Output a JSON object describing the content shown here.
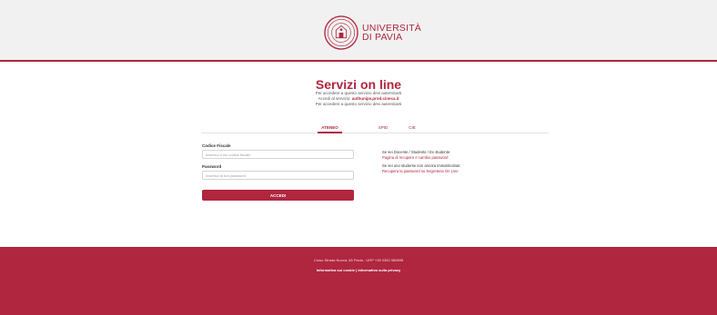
{
  "header": {
    "brand_line1": "UNIVERSITÀ",
    "brand_line2": "DI PAVIA"
  },
  "main": {
    "title": "Servizi on line",
    "line1": "Per accedere a questo servizio devi autenticarti",
    "line2_prefix": "Accedi al servizio:",
    "line2_service": "authunipv.prod.cineca.it",
    "line3": "Per accedere a questo servizio devi autenticarti"
  },
  "tabs": [
    {
      "label": "ATENEO",
      "active": true
    },
    {
      "label": "SPID",
      "active": false
    },
    {
      "label": "CIE",
      "active": false
    }
  ],
  "form": {
    "cf_label": "Codice Fiscale",
    "cf_placeholder": "Inserisci il tuo codice fiscale",
    "pw_label": "Password",
    "pw_placeholder": "Inserisci la tua password",
    "submit_label": "ACCEDI"
  },
  "help": {
    "staff_text": "Se sei Docente / Studente / Ex studente:",
    "staff_link": "Pagina di recupero e cambio password",
    "new_text": "Se sei uno studente non ancora immatricolato:",
    "new_link": "Recupera la password su Segreteria On Line"
  },
  "footer": {
    "address": "Corso Strada Nuova, 65 Pavia - URP +39 0382 989898",
    "cookie_link": "Informativa sui cookie",
    "separator": "|",
    "privacy_link": "Informativa sulla privacy"
  },
  "colors": {
    "brand": "#b0263f",
    "header_bg": "#f1f1f1"
  }
}
